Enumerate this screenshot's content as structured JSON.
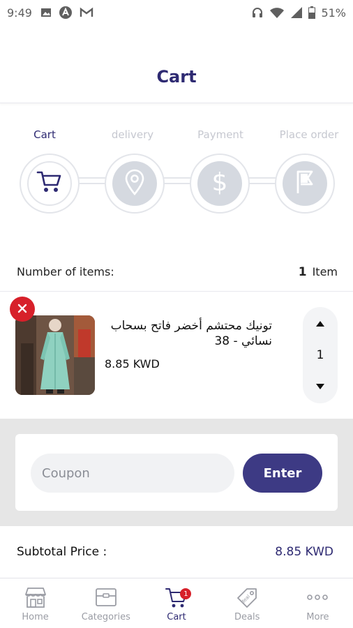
{
  "status_bar": {
    "time": "9:49",
    "battery": "51%",
    "icons": [
      "image-icon",
      "vpn-icon",
      "gmail-icon",
      "headphones-icon",
      "wifi-icon",
      "signal-icon",
      "battery-icon"
    ]
  },
  "header": {
    "title": "Cart"
  },
  "steps": [
    {
      "label": "Cart",
      "icon": "cart-icon",
      "active": true
    },
    {
      "label": "delivery",
      "icon": "location-pin-icon",
      "active": false
    },
    {
      "label": "Payment",
      "icon": "dollar-icon",
      "active": false
    },
    {
      "label": "Place order",
      "icon": "flag-icon",
      "active": false
    }
  ],
  "items_summary": {
    "label": "Number of items:",
    "count": "1",
    "unit": "Item"
  },
  "product": {
    "name": "تونيك محتشم أخضر فاتح بسحاب نسائي - 38",
    "price": "8.85 KWD",
    "quantity": "1"
  },
  "coupon": {
    "placeholder": "Coupon",
    "button_label": "Enter"
  },
  "subtotal": {
    "label": "Subtotal Price :",
    "value": "8.85 KWD"
  },
  "bottom_nav": [
    {
      "label": "Home",
      "icon": "store-icon",
      "active": false
    },
    {
      "label": "Categories",
      "icon": "box-icon",
      "active": false
    },
    {
      "label": "Cart",
      "icon": "cart-icon",
      "active": true,
      "badge": "1"
    },
    {
      "label": "Deals",
      "icon": "tag-icon",
      "active": false
    },
    {
      "label": "More",
      "icon": "more-dots-icon",
      "active": false
    }
  ],
  "colors": {
    "brand": "#2e2a72",
    "button": "#3d3a84",
    "remove": "#d7202a",
    "inactive": "#c6c8d0"
  }
}
